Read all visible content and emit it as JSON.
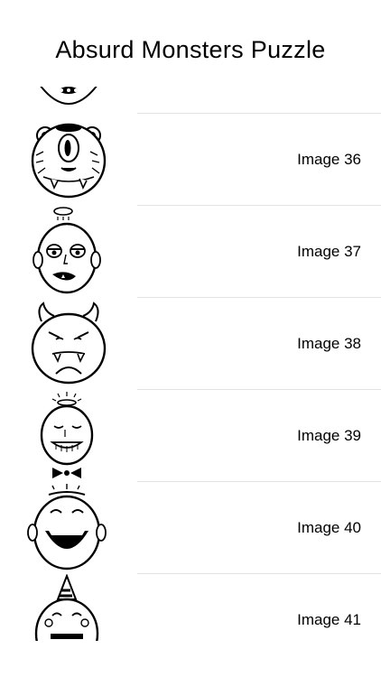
{
  "header": {
    "title": "Absurd Monsters Puzzle"
  },
  "list": {
    "items": [
      {
        "label": "Image 36",
        "icon": "cyclops-bear-monster-icon"
      },
      {
        "label": "Image 37",
        "icon": "sleepy-monster-icon"
      },
      {
        "label": "Image 38",
        "icon": "horned-monster-icon"
      },
      {
        "label": "Image 39",
        "icon": "angel-monster-icon"
      },
      {
        "label": "Image 40",
        "icon": "laughing-monster-icon"
      },
      {
        "label": "Image 41",
        "icon": "party-hat-monster-icon"
      }
    ]
  }
}
